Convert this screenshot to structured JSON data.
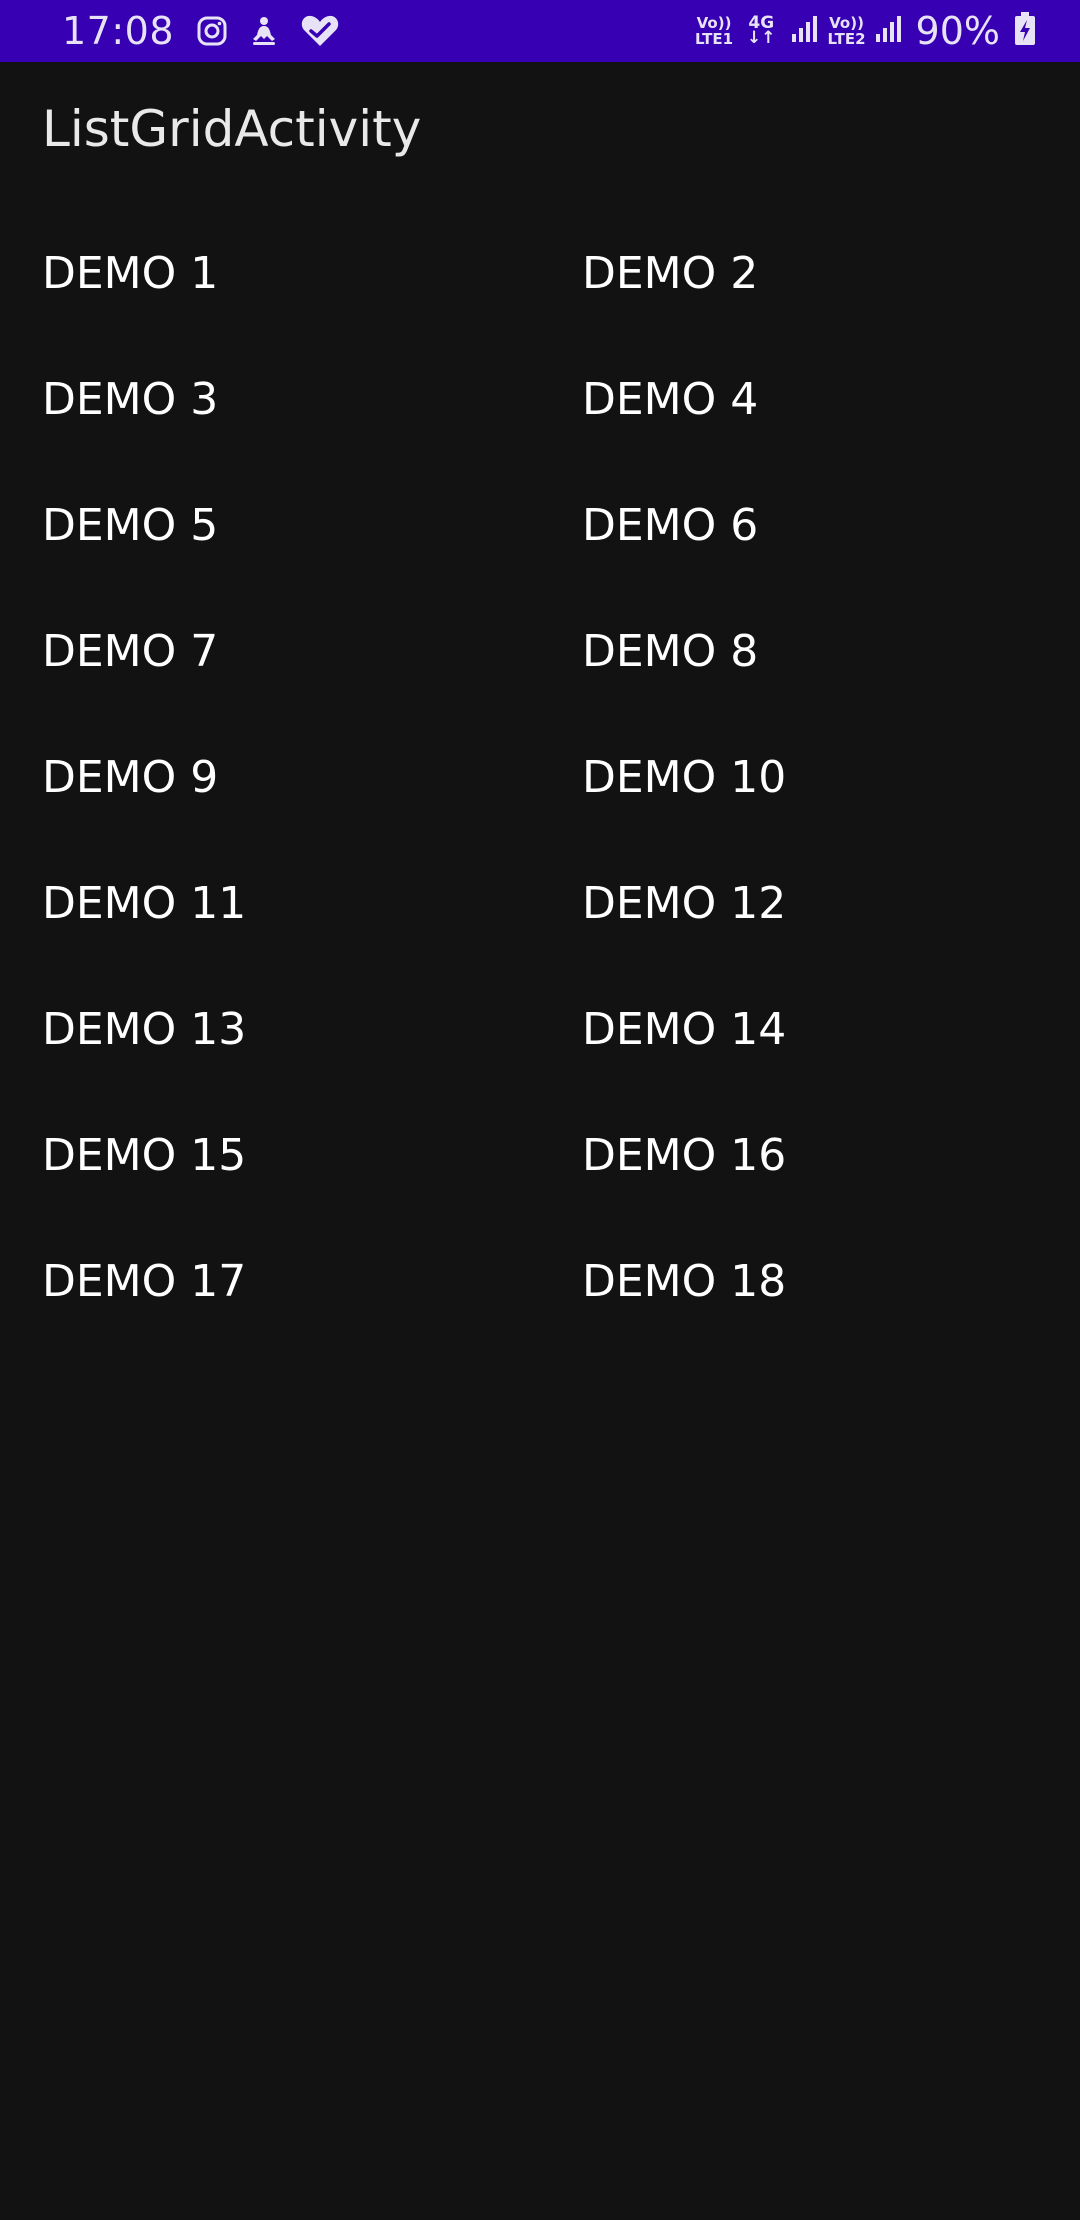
{
  "status_bar": {
    "time": "17:08",
    "net1_top": "Vo))",
    "net1_bottom": "LTE1",
    "net_type": "4G",
    "net_arrows": "↓↑",
    "net2_top": "Vo))",
    "net2_bottom": "LTE2",
    "battery": "90%",
    "icons": [
      "instagram-icon",
      "meditation-icon",
      "health-heart-icon",
      "signal-icon",
      "signal-icon",
      "battery-charging-icon"
    ],
    "background": "#3700b3"
  },
  "app": {
    "title": "ListGridActivity"
  },
  "grid": {
    "items": [
      "DEMO 1",
      "DEMO 2",
      "DEMO 3",
      "DEMO 4",
      "DEMO 5",
      "DEMO 6",
      "DEMO 7",
      "DEMO 8",
      "DEMO 9",
      "DEMO 10",
      "DEMO 11",
      "DEMO 12",
      "DEMO 13",
      "DEMO 14",
      "DEMO 15",
      "DEMO 16",
      "DEMO 17",
      "DEMO 18"
    ]
  },
  "theme": {
    "background": "#121212",
    "text": "#ffffff"
  }
}
